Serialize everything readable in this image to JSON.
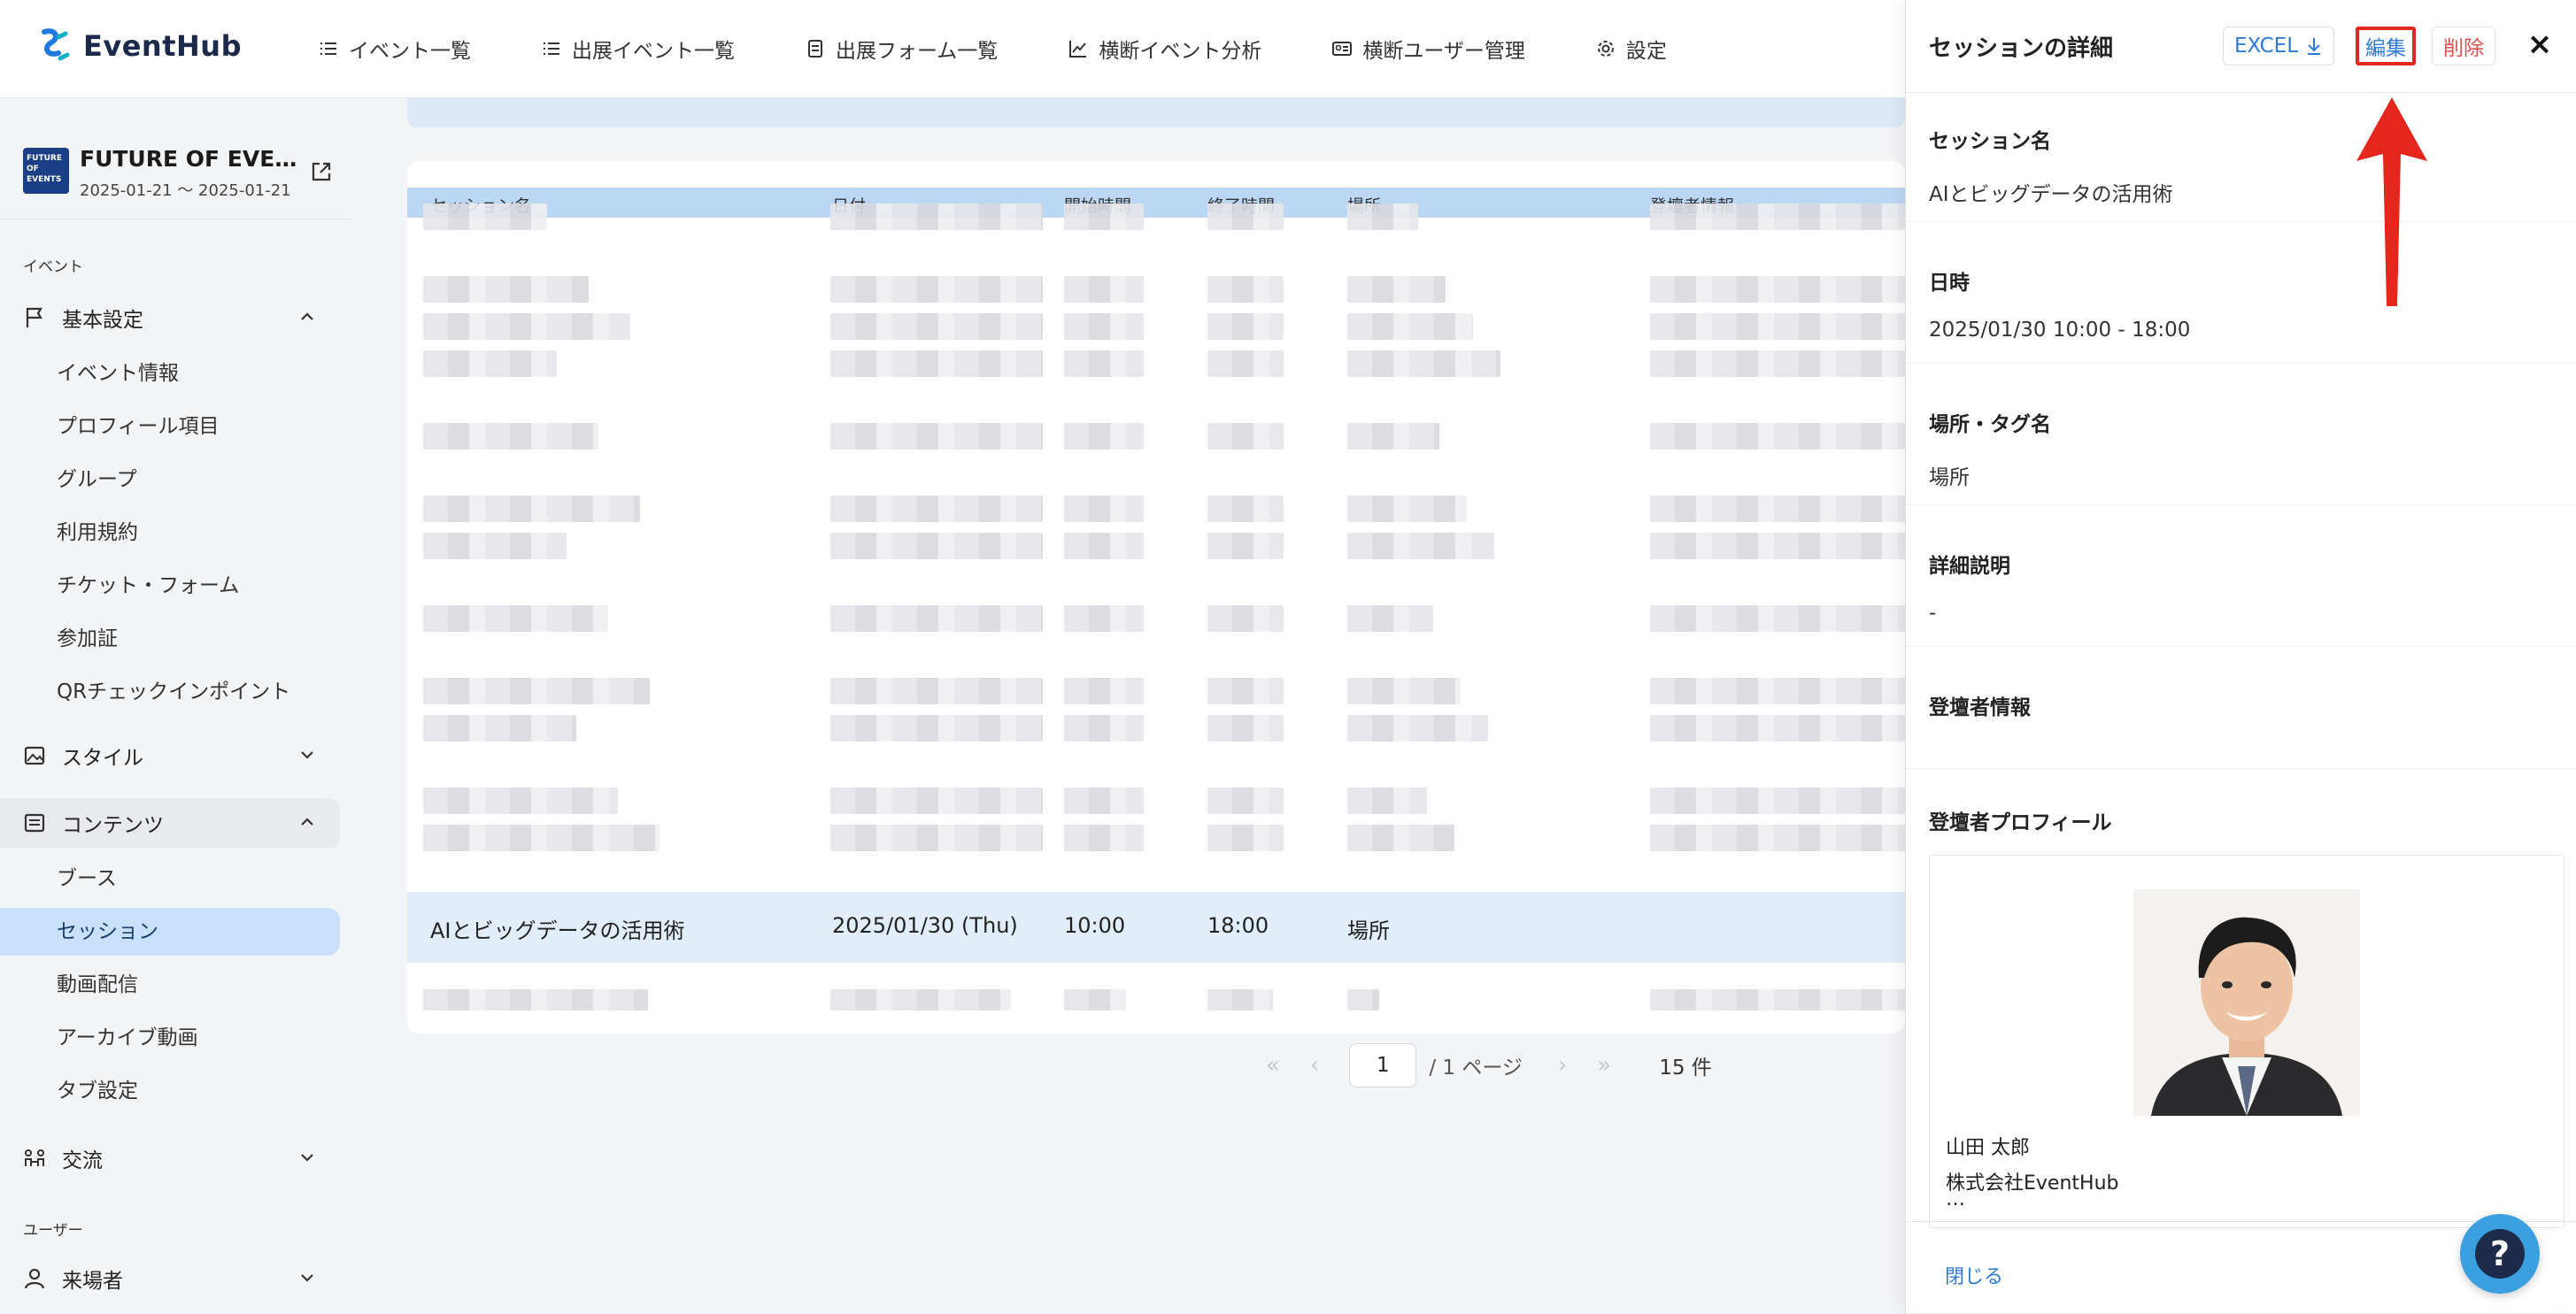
{
  "app": {
    "logo_text": "EventHub"
  },
  "nav": [
    {
      "label": "イベント一覧",
      "icon": "list-icon"
    },
    {
      "label": "出展イベント一覧",
      "icon": "list-icon"
    },
    {
      "label": "出展フォーム一覧",
      "icon": "form-icon"
    },
    {
      "label": "横断イベント分析",
      "icon": "chart-icon"
    },
    {
      "label": "横断ユーザー管理",
      "icon": "id-card-icon"
    },
    {
      "label": "設定",
      "icon": "gear-icon"
    }
  ],
  "event": {
    "thumb_text": "FUTURE OF EVENTS",
    "name": "FUTURE OF EVEN…",
    "dates": "2025-01-21 〜 2025-01-21"
  },
  "sidebar": {
    "section_event": "イベント",
    "section_user": "ユーザー",
    "basic": {
      "label": "基本設定"
    },
    "basic_items": [
      "イベント情報",
      "プロフィール項目",
      "グループ",
      "利用規約",
      "チケット・フォーム",
      "参加証",
      "QRチェックインポイント"
    ],
    "style": {
      "label": "スタイル"
    },
    "contents": {
      "label": "コンテンツ"
    },
    "content_items": [
      "ブース",
      "セッション",
      "動画配信",
      "アーカイブ動画",
      "タブ設定"
    ],
    "exchange": {
      "label": "交流"
    },
    "visitors": {
      "label": "来場者"
    }
  },
  "table": {
    "headers": [
      "セッション名",
      "日付",
      "開始時間",
      "終了時間",
      "場所",
      "登壇者情報"
    ],
    "highlight_row": {
      "name": "AIとビッグデータの活用術",
      "date": "2025/01/30 (Thu)",
      "start": "10:00",
      "end": "18:00",
      "place": "場所"
    }
  },
  "pager": {
    "page": "1",
    "total_pages": "/ 1 ページ",
    "count": "15 件"
  },
  "drawer": {
    "title": "セッションの詳細",
    "excel_label": "EXCEL",
    "edit_label": "編集",
    "delete_label": "削除",
    "close_icon": "×",
    "fields": {
      "name_label": "セッション名",
      "name_value": "AIとビッグデータの活用術",
      "datetime_label": "日時",
      "datetime_value": "2025/01/30 10:00 - 18:00",
      "place_label": "場所・タグ名",
      "place_value": "場所",
      "desc_label": "詳細説明",
      "desc_value": "-",
      "speaker_label": "登壇者情報",
      "profile_label": "登壇者プロフィール"
    },
    "profile": {
      "name": "山田 太郎",
      "company": "株式会社EventHub",
      "more": "…"
    },
    "footer_close": "閉じる"
  },
  "help": {
    "label": "?"
  },
  "colors": {
    "accent": "#2d7bd6",
    "highlight_border": "#e5261c",
    "active_item": "#c9e0fa"
  }
}
